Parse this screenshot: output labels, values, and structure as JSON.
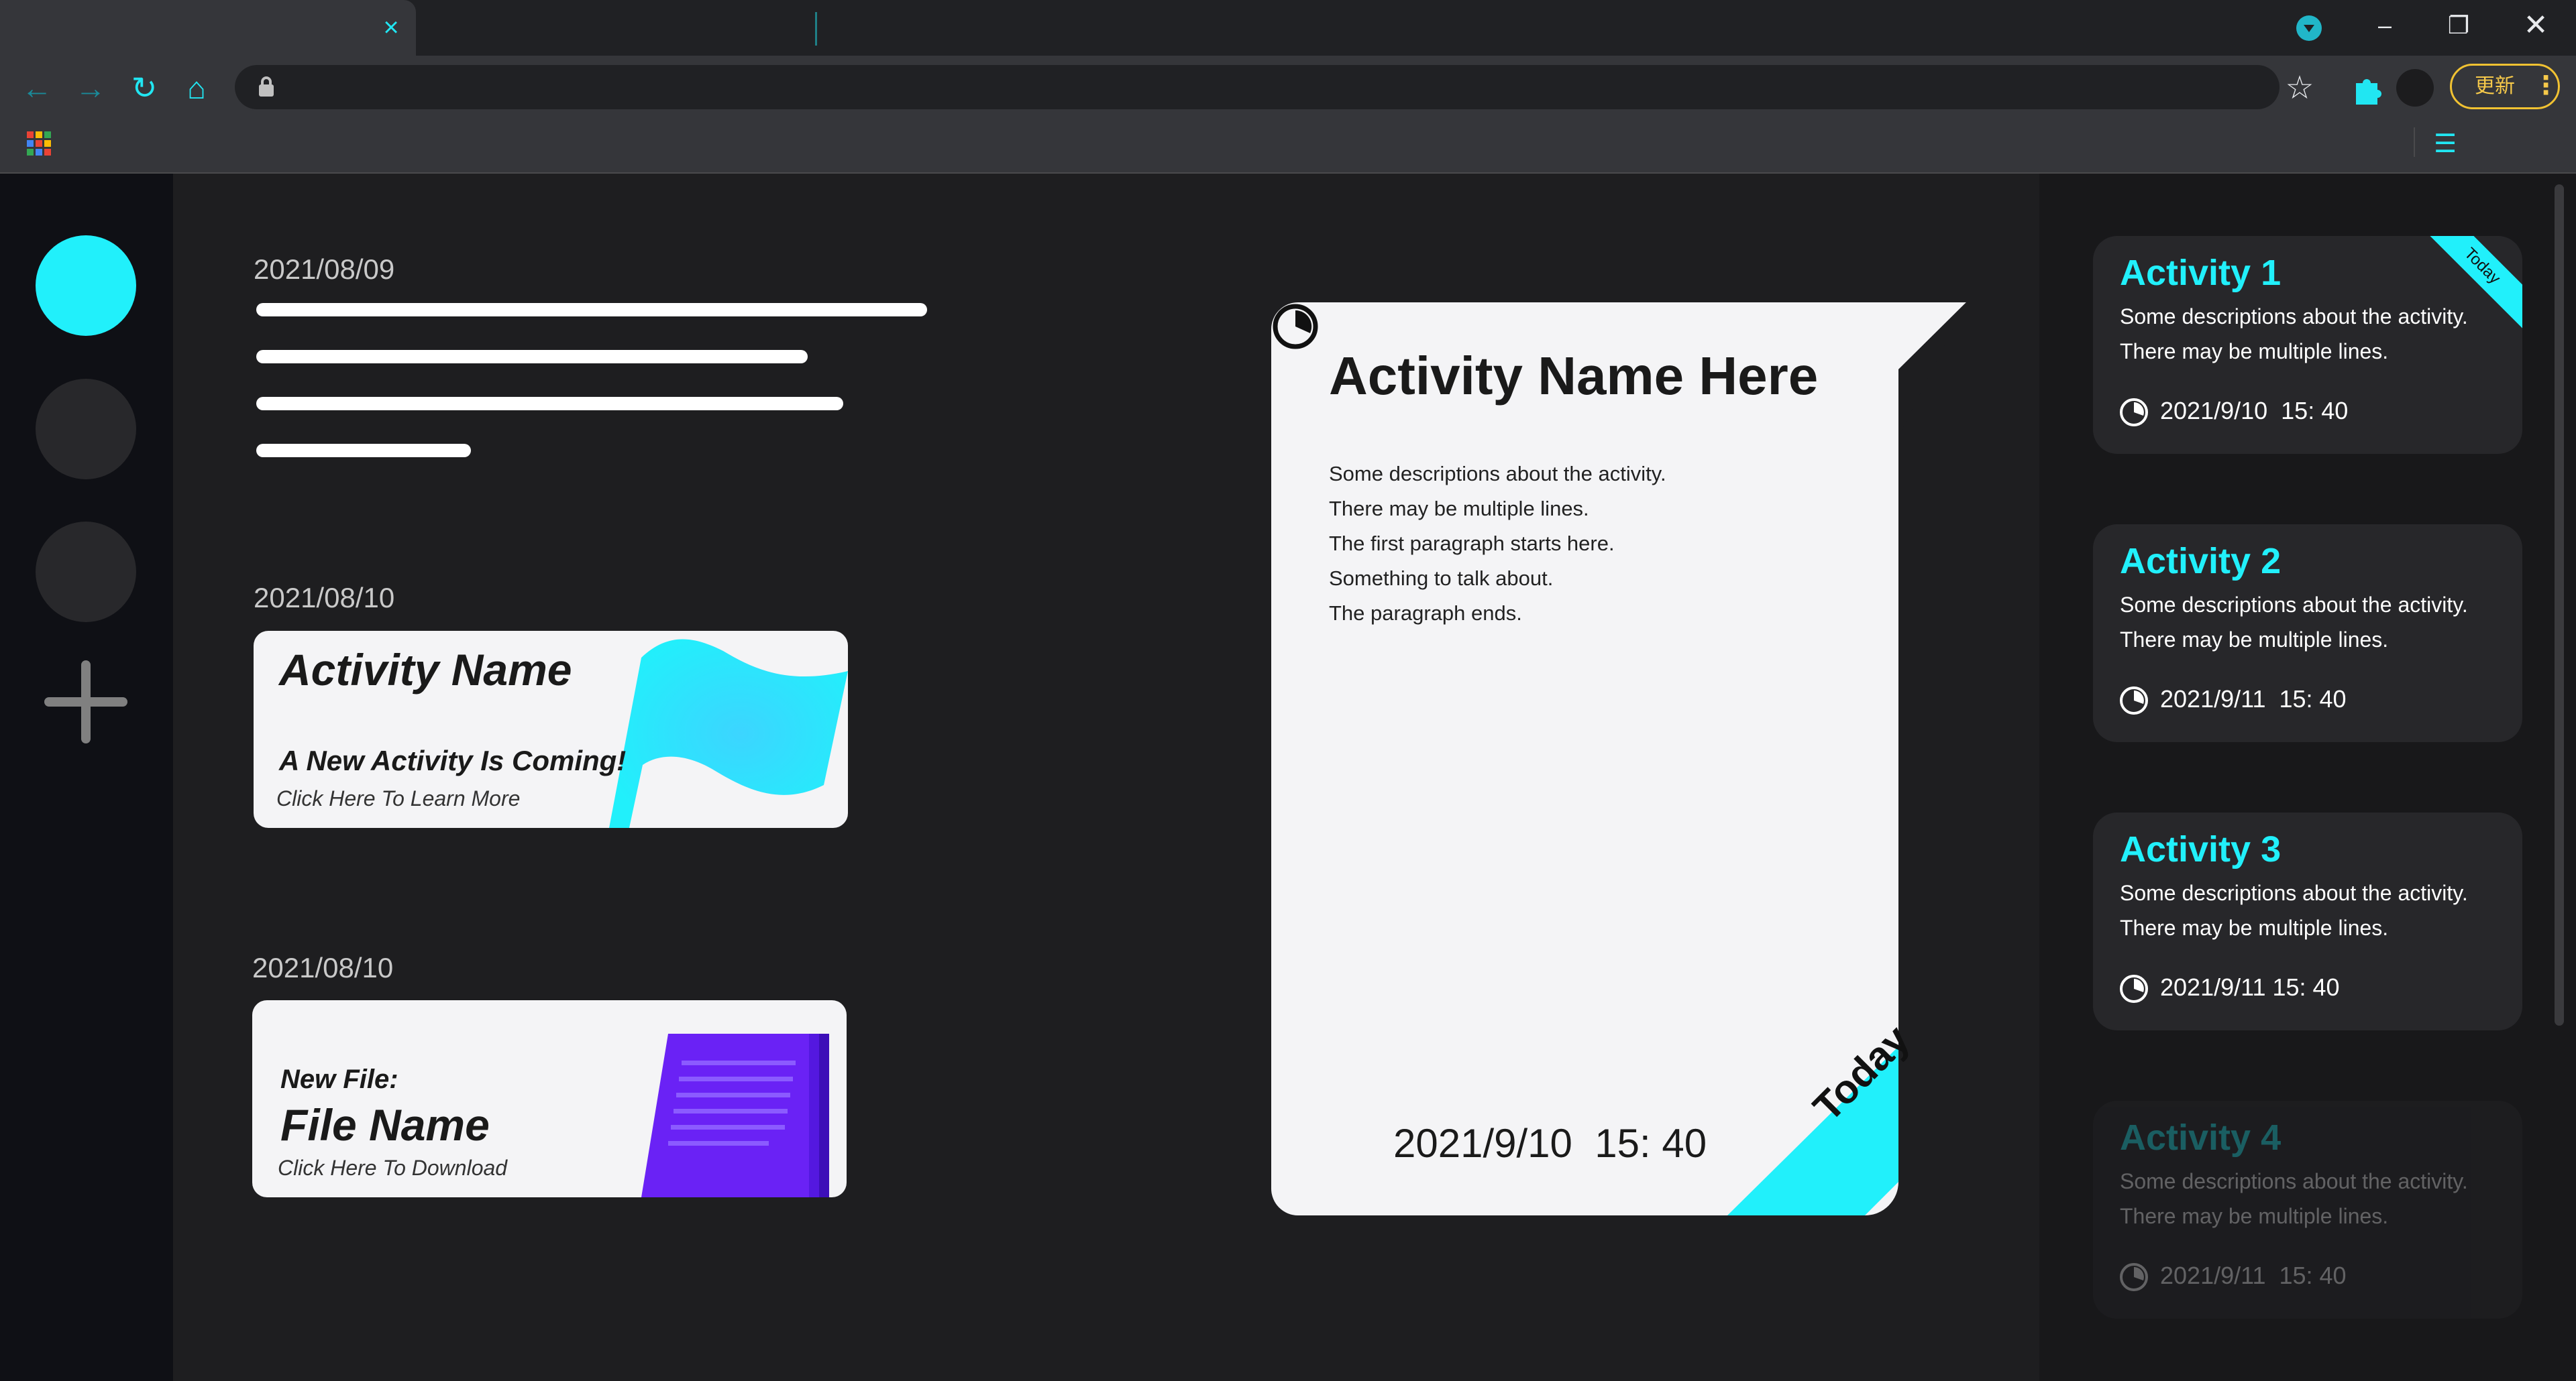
{
  "browser": {
    "tab_close": "×",
    "window_minimize": "–",
    "window_maximize": "❐",
    "window_close": "✕",
    "nav": {
      "back": "←",
      "forward": "→",
      "reload": "↻",
      "home": "⌂",
      "lock": "🔒",
      "star": "☆",
      "extensions": "✚"
    },
    "update_label": "更新",
    "update_menu": "⋮",
    "reading_list": "☰",
    "apps_colors": [
      "#ea4335",
      "#fbbc05",
      "#34a853",
      "#4285f4",
      "#ea4335",
      "#fbbc05",
      "#34a853",
      "#4285f4",
      "#ea4335"
    ]
  },
  "feed": {
    "dates": [
      "2021/08/09",
      "2021/08/10",
      "2021/08/10"
    ],
    "promo_activity": {
      "title": "Activity Name",
      "subtitle": "A New Activity Is Coming!",
      "link": "Click Here To Learn More"
    },
    "promo_file": {
      "label": "New File:",
      "title": "File Name",
      "link": "Click Here To Download"
    }
  },
  "detail": {
    "title": "Activity Name Here",
    "description": [
      "Some descriptions about the activity.",
      "There may be multiple lines.",
      "The first paragraph starts here.",
      "Something to talk about.",
      "The paragraph ends."
    ],
    "time": "2021/9/10  15: 40",
    "badge": "Today"
  },
  "activities": [
    {
      "title": "Activity 1",
      "desc1": "Some descriptions about the activity.",
      "desc2": "There may be multiple lines.",
      "time": "2021/9/10  15: 40",
      "badge": "Today"
    },
    {
      "title": "Activity 2",
      "desc1": "Some descriptions about the activity.",
      "desc2": "There may be multiple lines.",
      "time": "2021/9/11  15: 40"
    },
    {
      "title": "Activity 3",
      "desc1": "Some descriptions about the activity.",
      "desc2": "There may be multiple lines.",
      "time": "2021/9/11 15: 40"
    },
    {
      "title": "Activity 4",
      "desc1": "Some descriptions about the activity.",
      "desc2": "There may be multiple lines.",
      "time": "2021/9/11  15: 40"
    }
  ],
  "colors": {
    "accent": "#21f0fb",
    "file_purple": "#6a22f5",
    "card_bg": "#f4f4f6"
  }
}
